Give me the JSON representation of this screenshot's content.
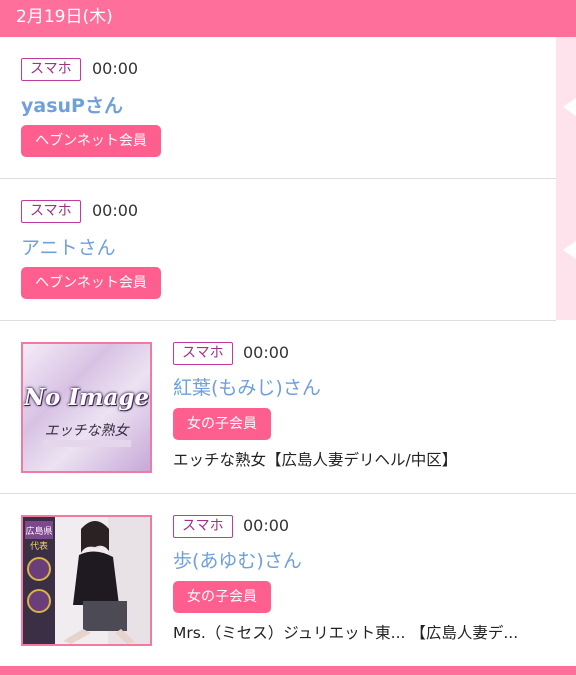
{
  "header": {
    "date": "2月19日(木)"
  },
  "entries": [
    {
      "device": "スマホ",
      "time": "00:00",
      "name": "yasuPさん",
      "member_type": "ヘブンネット会員"
    },
    {
      "device": "スマホ",
      "time": "00:00",
      "name": "アニトさん",
      "member_type": "ヘブンネット会員"
    },
    {
      "device": "スマホ",
      "time": "00:00",
      "name": "紅葉(もみじ)さん",
      "member_type": "女の子会員",
      "shop": "エッチな熟女【広島人妻デリヘル/中区】",
      "thumb": {
        "title": "No Image",
        "subtitle": "エッチな熟女"
      }
    },
    {
      "device": "スマホ",
      "time": "00:00",
      "name": "歩(あゆむ)さん",
      "member_type": "女の子会員",
      "shop": "Mrs.（ミセス）ジュリエット東... 【広島人妻デ...",
      "thumb": {
        "badge": "広島県",
        "badge2": "代表"
      }
    }
  ],
  "colors": {
    "accent": "#ff6f9c",
    "name_link": "#6fa0dc",
    "badge_border": "#c03aa0"
  }
}
